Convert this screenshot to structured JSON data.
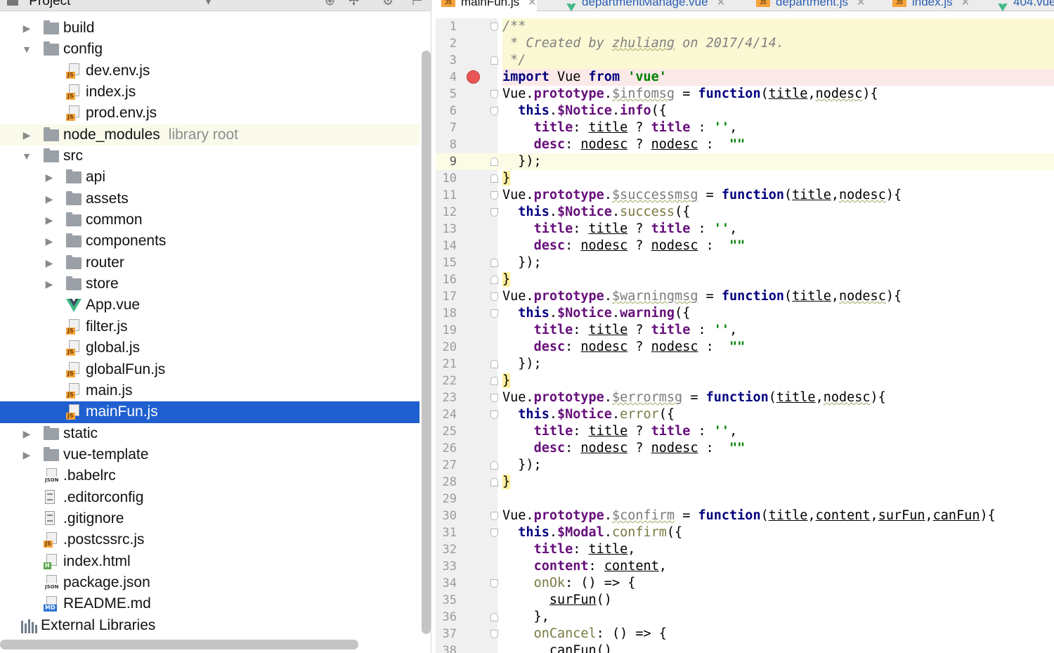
{
  "project_panel": {
    "title": "Project",
    "tree": [
      {
        "name": "build",
        "kind": "folder",
        "depth": 0,
        "expanded": false
      },
      {
        "name": "config",
        "kind": "folder",
        "depth": 0,
        "expanded": true
      },
      {
        "name": "dev.env.js",
        "kind": "js",
        "depth": 1
      },
      {
        "name": "index.js",
        "kind": "js",
        "depth": 1
      },
      {
        "name": "prod.env.js",
        "kind": "js",
        "depth": 1
      },
      {
        "name": "node_modules",
        "kind": "folder",
        "depth": 0,
        "expanded": false,
        "tag": "library root"
      },
      {
        "name": "src",
        "kind": "folder",
        "depth": 0,
        "expanded": true
      },
      {
        "name": "api",
        "kind": "folder",
        "depth": 1,
        "expanded": false
      },
      {
        "name": "assets",
        "kind": "folder",
        "depth": 1,
        "expanded": false
      },
      {
        "name": "common",
        "kind": "folder",
        "depth": 1,
        "expanded": false
      },
      {
        "name": "components",
        "kind": "folder",
        "depth": 1,
        "expanded": false
      },
      {
        "name": "router",
        "kind": "folder",
        "depth": 1,
        "expanded": false
      },
      {
        "name": "store",
        "kind": "folder",
        "depth": 1,
        "expanded": false
      },
      {
        "name": "App.vue",
        "kind": "vue",
        "depth": 1
      },
      {
        "name": "filter.js",
        "kind": "js",
        "depth": 1
      },
      {
        "name": "global.js",
        "kind": "js",
        "depth": 1
      },
      {
        "name": "globalFun.js",
        "kind": "js",
        "depth": 1
      },
      {
        "name": "main.js",
        "kind": "js",
        "depth": 1
      },
      {
        "name": "mainFun.js",
        "kind": "js",
        "depth": 1,
        "selected": true
      },
      {
        "name": "static",
        "kind": "folder",
        "depth": 0,
        "expanded": false
      },
      {
        "name": "vue-template",
        "kind": "folder",
        "depth": 0,
        "expanded": false
      },
      {
        "name": ".babelrc",
        "kind": "json",
        "depth": 0
      },
      {
        "name": ".editorconfig",
        "kind": "text",
        "depth": 0
      },
      {
        "name": ".gitignore",
        "kind": "text",
        "depth": 0
      },
      {
        "name": ".postcssrc.js",
        "kind": "js",
        "depth": 0
      },
      {
        "name": "index.html",
        "kind": "html",
        "depth": 0
      },
      {
        "name": "package.json",
        "kind": "json",
        "depth": 0
      },
      {
        "name": "README.md",
        "kind": "md",
        "depth": 0
      },
      {
        "name": "External Libraries",
        "kind": "libraries",
        "depth": -1
      }
    ]
  },
  "editor": {
    "tabs": [
      {
        "label": "mainFun.js",
        "icon": "js",
        "active": true
      },
      {
        "label": "departmentManage.vue",
        "icon": "vue"
      },
      {
        "label": "department.js",
        "icon": "js"
      },
      {
        "label": "index.js",
        "icon": "js"
      },
      {
        "label": "404.vue",
        "icon": "vue"
      }
    ],
    "breakpoint_line": 4,
    "current_line": 9,
    "lines": [
      "/**",
      " * Created by zhuliang on 2017/4/14.",
      " */",
      "import Vue from 'vue'",
      "Vue.prototype.$infomsg = function(title,nodesc){",
      "  this.$Notice.info({",
      "    title: title ? title : '',",
      "    desc: nodesc ? nodesc :  \"\"",
      "  });",
      "}",
      "Vue.prototype.$successmsg = function(title,nodesc){",
      "  this.$Notice.success({",
      "    title: title ? title : '',",
      "    desc: nodesc ? nodesc :  \"\"",
      "  });",
      "}",
      "Vue.prototype.$warningmsg = function(title,nodesc){",
      "  this.$Notice.warning({",
      "    title: title ? title : '',",
      "    desc: nodesc ? nodesc :  \"\"",
      "  });",
      "}",
      "Vue.prototype.$errormsg = function(title,nodesc){",
      "  this.$Notice.error({",
      "    title: title ? title : '',",
      "    desc: nodesc ? nodesc :  \"\"",
      "  });",
      "}",
      "",
      "Vue.prototype.$confirm = function(title,content,surFun,canFun){",
      "  this.$Modal.confirm({",
      "    title: title,",
      "    content: content,",
      "    onOk: () => {",
      "      surFun()",
      "    },",
      "    onCancel: () => {",
      "      canFun()"
    ]
  }
}
